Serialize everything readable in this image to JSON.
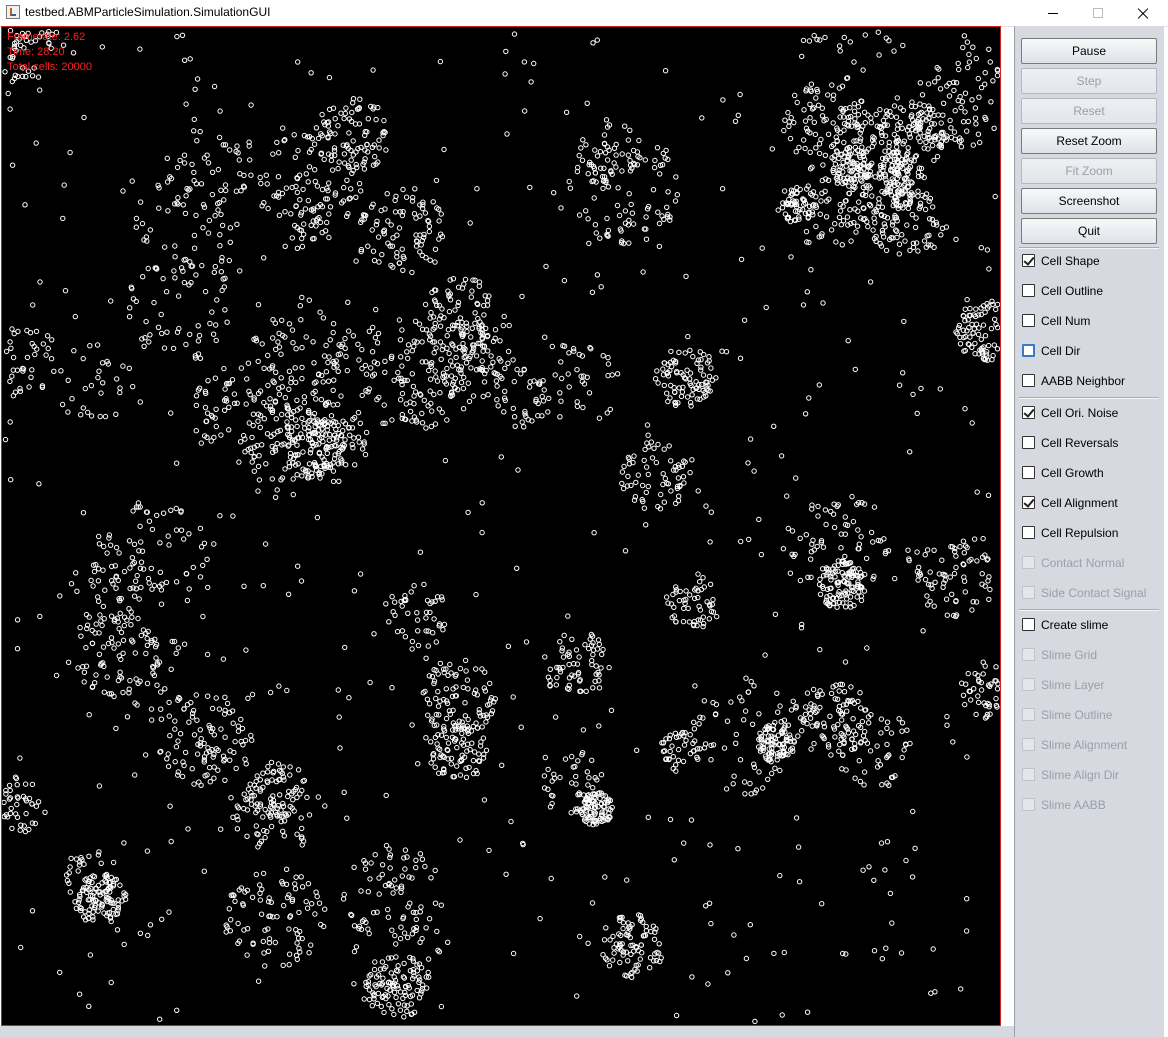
{
  "window": {
    "title": "testbed.ABMParticleSimulation.SimulationGUI"
  },
  "overlay": {
    "framerate": "Framerate: 2.62",
    "time": "Time: 28.20",
    "total_cells": "Total cells: 20000",
    "text_color": "#ff2020"
  },
  "simulation": {
    "background": "#000000",
    "particle_color": "#ffffff",
    "border_color": "#d02020"
  },
  "controls": {
    "buttons": [
      {
        "label": "Pause",
        "enabled": true
      },
      {
        "label": "Step",
        "enabled": false
      },
      {
        "label": "Reset",
        "enabled": false
      },
      {
        "label": "Reset Zoom",
        "enabled": true
      },
      {
        "label": "Fit Zoom",
        "enabled": false
      },
      {
        "label": "Screenshot",
        "enabled": true
      },
      {
        "label": "Quit",
        "enabled": true
      }
    ],
    "display_group": [
      {
        "label": "Cell Shape",
        "checked": true,
        "enabled": true
      },
      {
        "label": "Cell Outline",
        "checked": false,
        "enabled": true
      },
      {
        "label": "Cell Num",
        "checked": false,
        "enabled": true
      },
      {
        "label": "Cell Dir",
        "checked": false,
        "enabled": true,
        "focused": true
      },
      {
        "label": "AABB Neighbor",
        "checked": false,
        "enabled": true
      }
    ],
    "behavior_group": [
      {
        "label": "Cell Ori. Noise",
        "checked": true,
        "enabled": true
      },
      {
        "label": "Cell Reversals",
        "checked": false,
        "enabled": true
      },
      {
        "label": "Cell Growth",
        "checked": false,
        "enabled": true
      },
      {
        "label": "Cell Alignment",
        "checked": true,
        "enabled": true
      },
      {
        "label": "Cell Repulsion",
        "checked": false,
        "enabled": true
      },
      {
        "label": "Contact Normal",
        "checked": false,
        "enabled": false
      },
      {
        "label": "Side Contact Signal",
        "checked": false,
        "enabled": false
      }
    ],
    "slime_group": [
      {
        "label": "Create slime",
        "checked": false,
        "enabled": true
      },
      {
        "label": "Slime Grid",
        "checked": false,
        "enabled": false
      },
      {
        "label": "Slime Layer",
        "checked": false,
        "enabled": false
      },
      {
        "label": "Slime Outline",
        "checked": false,
        "enabled": false
      },
      {
        "label": "Slime Alignment",
        "checked": false,
        "enabled": false
      },
      {
        "label": "Slime Align Dir",
        "checked": false,
        "enabled": false
      },
      {
        "label": "Slime AABB",
        "checked": false,
        "enabled": false
      }
    ]
  }
}
